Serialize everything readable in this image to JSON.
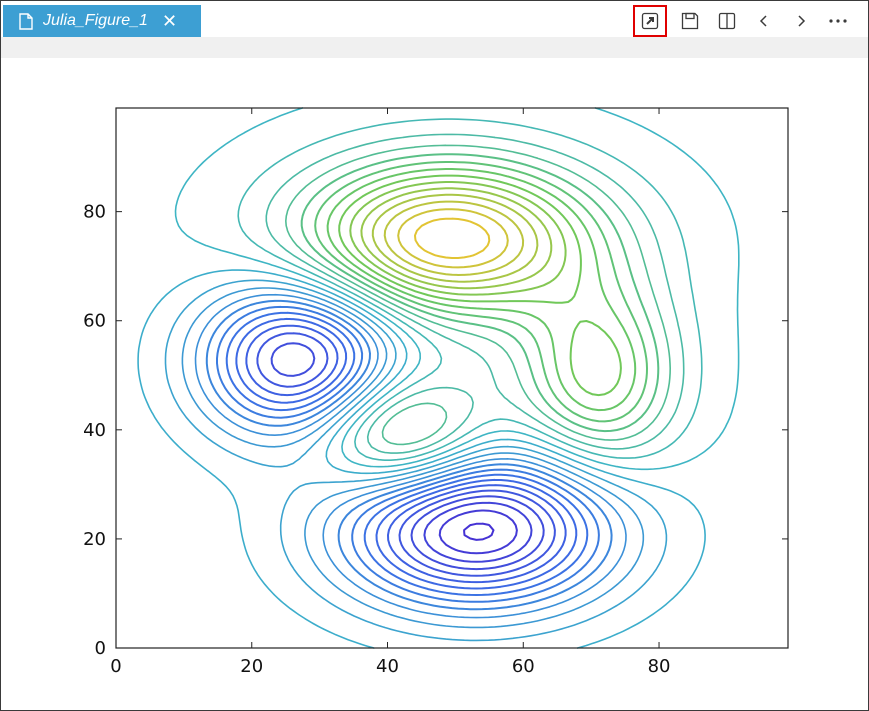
{
  "tab": {
    "title": "Julia_Figure_1",
    "close_glyph": "✕"
  },
  "toolbar": {
    "buttons": [
      {
        "name": "open-external-button",
        "icon": "open-external-icon",
        "highlighted": true
      },
      {
        "name": "save-button",
        "icon": "save-icon"
      },
      {
        "name": "split-view-button",
        "icon": "split-view-icon"
      },
      {
        "name": "previous-button",
        "icon": "chevron-left-icon",
        "glyph": "‹"
      },
      {
        "name": "next-button",
        "icon": "chevron-right-icon",
        "glyph": "›"
      },
      {
        "name": "more-button",
        "icon": "more-icon",
        "glyph": "···"
      }
    ],
    "highlight_color": "#e00000"
  },
  "chart_data": {
    "type": "contour",
    "title": "",
    "xlabel": "",
    "ylabel": "",
    "xlim": [
      0,
      99
    ],
    "ylim": [
      0,
      99
    ],
    "xticks": [
      0,
      20,
      40,
      60,
      80
    ],
    "yticks": [
      0,
      20,
      40,
      60,
      80
    ],
    "grid": false,
    "colormap": "viridis-like (blue → green → yellow)",
    "peaks": [
      {
        "x": 49,
        "y": 75,
        "level": "max",
        "color": "#f2c12e"
      },
      {
        "x": 71,
        "y": 50,
        "level": "mid-high",
        "color": "#6fc95c"
      },
      {
        "x": 42,
        "y": 39,
        "level": "mid-high",
        "color": "#74c95a"
      },
      {
        "x": 27,
        "y": 53,
        "level": "min",
        "color": "#3a5fe3"
      },
      {
        "x": 53,
        "y": 22,
        "level": "min",
        "color": "#4a3bd8"
      }
    ]
  }
}
